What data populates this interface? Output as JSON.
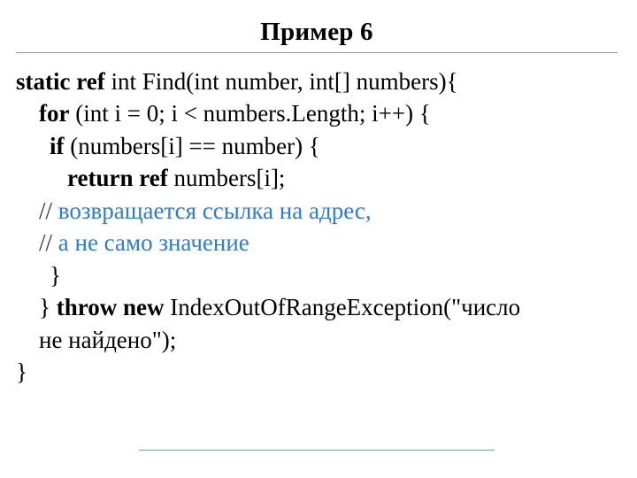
{
  "title": "Пример 6",
  "code": {
    "l1": {
      "kw": "static ref",
      "rest": " int Find(int number, int[] numbers){"
    },
    "l2": {
      "kw": "for",
      "rest": " (int i = 0; i < numbers.Length; i++) {"
    },
    "l3": {
      "kw": "if",
      "rest": " (numbers[i] == number) {"
    },
    "l4": {
      "kw": "return ref",
      "rest": " numbers[i];"
    },
    "l5": {
      "slash": "// ",
      "comment": "возвращается ссылка на адрес,"
    },
    "l6": {
      "slash": "// ",
      "comment": "а не само значение"
    },
    "l7": "}",
    "l8": {
      "close": "}  ",
      "kw": "throw new",
      "rest": " IndexOutOfRangeException(\"число"
    },
    "l9": "не найдено\");",
    "l10": "}"
  }
}
